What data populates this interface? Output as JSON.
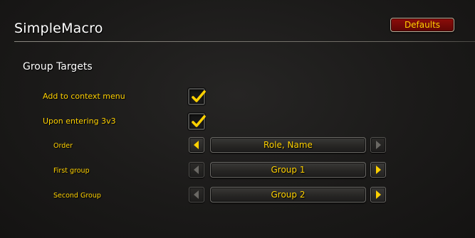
{
  "app": {
    "title": "SimpleMacro"
  },
  "toolbar": {
    "defaults_label": "Defaults"
  },
  "colors": {
    "accent_gold": "#ffd100",
    "button_red": "#7a0906",
    "background": "#1e1d1c"
  },
  "section": {
    "title": "Group Targets",
    "options": [
      {
        "label": "Add to context menu",
        "checked": true
      },
      {
        "label": "Upon entering 3v3",
        "checked": true
      }
    ],
    "selectors": [
      {
        "label": "Order",
        "value": "Role, Name",
        "left_enabled": true,
        "right_enabled": false
      },
      {
        "label": "First group",
        "value": "Group 1",
        "left_enabled": false,
        "right_enabled": true
      },
      {
        "label": "Second Group",
        "value": "Group 2",
        "left_enabled": false,
        "right_enabled": true
      }
    ]
  },
  "icons": {
    "checkmark": "checkmark-icon",
    "left_arrow": "arrow-left-icon",
    "right_arrow": "arrow-right-icon"
  }
}
